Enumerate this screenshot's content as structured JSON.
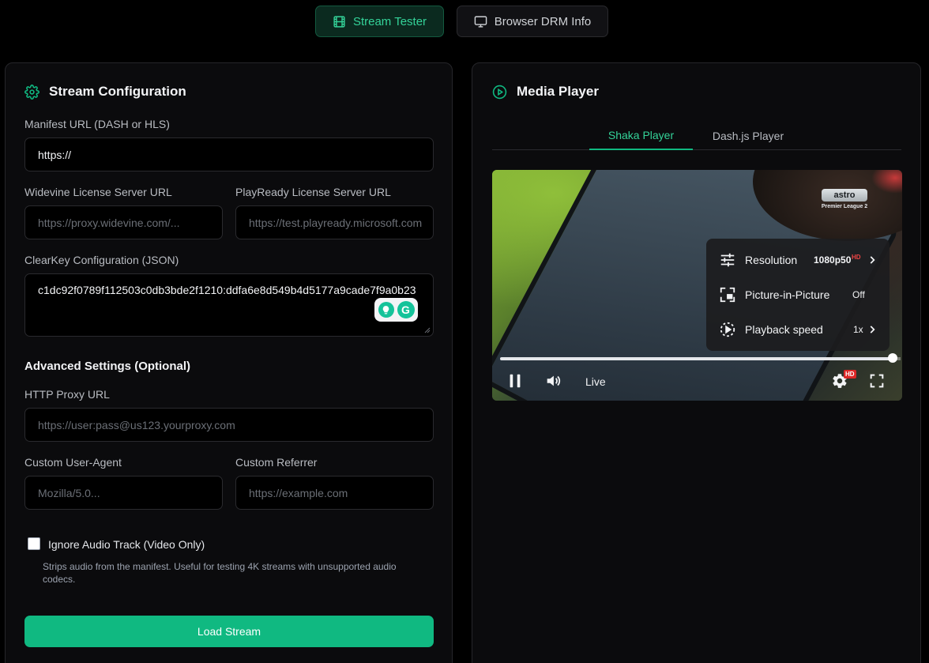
{
  "topnav": {
    "stream_tester": "Stream Tester",
    "browser_drm": "Browser DRM Info"
  },
  "config": {
    "title": "Stream Configuration",
    "manifest_label": "Manifest URL (DASH or HLS)",
    "manifest_value": "https://",
    "widevine_label": "Widevine License Server URL",
    "widevine_placeholder": "https://proxy.widevine.com/...",
    "playready_label": "PlayReady License Server URL",
    "playready_placeholder": "https://test.playready.microsoft.com",
    "clearkey_label": "ClearKey Configuration (JSON)",
    "clearkey_value": "c1dc92f0789f112503c0db3bde2f1210:ddfa6e8d549b4d5177a9cade7f9a0b23",
    "advanced_title": "Advanced Settings (Optional)",
    "proxy_label": "HTTP Proxy URL",
    "proxy_placeholder": "https://user:pass@us123.yourproxy.com",
    "ua_label": "Custom User-Agent",
    "ua_placeholder": "Mozilla/5.0...",
    "referrer_label": "Custom Referrer",
    "referrer_placeholder": "https://example.com",
    "ignore_audio_label": "Ignore Audio Track (Video Only)",
    "ignore_audio_checked": false,
    "ignore_audio_help": "Strips audio from the manifest. Useful for testing 4K streams with unsupported audio codecs.",
    "load_button": "Load Stream"
  },
  "player": {
    "title": "Media Player",
    "tabs": [
      "Shaka Player",
      "Dash.js Player"
    ],
    "active_tab": "Shaka Player",
    "watermark": {
      "logo": "astro",
      "sub": "Premier League 2"
    },
    "settings_menu": {
      "resolution_label": "Resolution",
      "resolution_value": "1080p50",
      "resolution_badge": "HD",
      "pip_label": "Picture-in-Picture",
      "pip_value": "Off",
      "speed_label": "Playback speed",
      "speed_value": "1x"
    },
    "live_label": "Live",
    "settings_badge": "HD",
    "seek_progress": 0.98
  },
  "colors": {
    "accent": "#10b981",
    "accent_text": "#34d399",
    "background": "#000000",
    "panel": "#0b0b0d",
    "badge_red": "#dc2626"
  },
  "icons": {
    "stream_tester": "film-icon",
    "browser_drm": "monitor-icon",
    "config": "gear-icon",
    "player": "play-circle-icon"
  }
}
